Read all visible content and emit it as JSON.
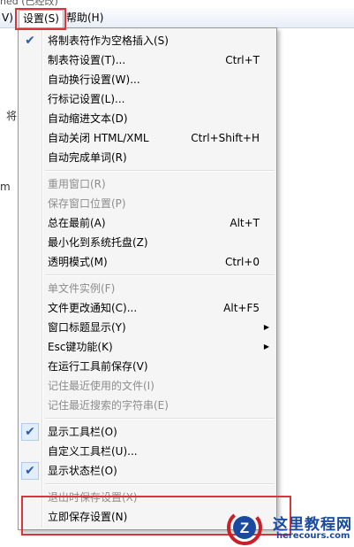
{
  "window": {
    "title_fragment": "ned (已经改)"
  },
  "menubar": {
    "items": [
      {
        "label": "V)"
      },
      {
        "label": "设置(S)"
      },
      {
        "label": "帮助(H)"
      }
    ]
  },
  "background": {
    "fragment_jiang": "将",
    "fragment_m": "m"
  },
  "menu": {
    "groups": [
      [
        {
          "label": "将制表符作为空格插入(S)",
          "checked": true
        },
        {
          "label": "制表符设置(T)...",
          "shortcut": "Ctrl+T"
        },
        {
          "label": "自动换行设置(W)..."
        },
        {
          "label": "行标记设置(L)..."
        },
        {
          "label": "自动缩进文本(D)"
        },
        {
          "label": "自动关闭 HTML/XML",
          "shortcut": "Ctrl+Shift+H"
        },
        {
          "label": "自动完成单词(R)"
        }
      ],
      [
        {
          "label": "重用窗口(R)",
          "disabled": true
        },
        {
          "label": "保存窗口位置(P)",
          "disabled": true
        },
        {
          "label": "总在最前(A)",
          "shortcut": "Alt+T"
        },
        {
          "label": "最小化到系统托盘(Z)"
        },
        {
          "label": "透明模式(M)",
          "shortcut": "Ctrl+0"
        }
      ],
      [
        {
          "label": "单文件实例(F)",
          "disabled": true
        },
        {
          "label": "文件更改通知(C)...",
          "shortcut": "Alt+F5"
        },
        {
          "label": "窗口标题显示(Y)",
          "submenu": true
        },
        {
          "label": "Esc键功能(K)",
          "submenu": true
        },
        {
          "label": "在运行工具前保存(V)"
        },
        {
          "label": "记住最近使用的文件(I)",
          "disabled": true
        },
        {
          "label": "记住最近搜索的字符串(E)",
          "disabled": true
        }
      ],
      [
        {
          "label": "显示工具栏(O)",
          "checked": true,
          "framed": true
        },
        {
          "label": "自定义工具栏(U)..."
        },
        {
          "label": "显示状态栏(O)",
          "checked": true,
          "framed": true
        }
      ],
      [
        {
          "label": "退出时保存设置(X)",
          "disabled": true
        },
        {
          "label": "立即保存设置(N)"
        }
      ]
    ]
  },
  "icons": {
    "check": "✔",
    "submenu_arrow": "▶"
  },
  "watermark": {
    "logo_letter": "Z",
    "title": "这里教程网",
    "url": "herecours.com"
  },
  "colors": {
    "highlight": "#d9353a",
    "check": "#2a5db0",
    "disabled_text": "#8d8d8d",
    "watermark_blue": "#1a4aa0",
    "watermark_red": "#c8202a"
  }
}
